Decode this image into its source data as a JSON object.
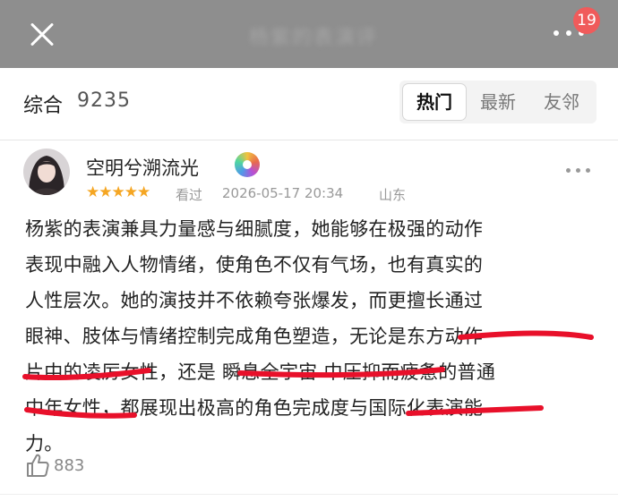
{
  "topbar": {
    "title": "杨紫的表演评",
    "notification_count": "19",
    "close_icon": "close-icon",
    "more_icon": "more-icon"
  },
  "filter": {
    "section_title": "综合",
    "count": "9235",
    "sort_tabs": [
      "热门",
      "最新",
      "友邻"
    ],
    "active_tab": "热门"
  },
  "comment": {
    "username": "空明兮溯流光",
    "rating_stars": 5,
    "stars_text": "★★★★★",
    "status": "看过",
    "datetime": "2026-05-17 20:34",
    "location": "山东",
    "lines": [
      "杨紫的表演兼具力量感与细腻度，她能够在极强的动作",
      "表现中融入人物情绪，使角色不仅有气场，也有真实的",
      "人性层次。她的演技并不依赖夸张爆发，而更擅长通过",
      "眼神、肢体与情绪控制完成角色塑造，无论是东方动作",
      "片中的凌厉女性，还是 瞬息全宇宙 中压抑而疲惫的普通",
      "中年女性，都展现出极高的角色完成度与国际化表演能",
      "力。"
    ],
    "likes": "883"
  },
  "colors": {
    "topbar": "#8e8e8e",
    "badge": "#f05b5b",
    "star": "#f5a623",
    "annotation": "#e8102a"
  }
}
